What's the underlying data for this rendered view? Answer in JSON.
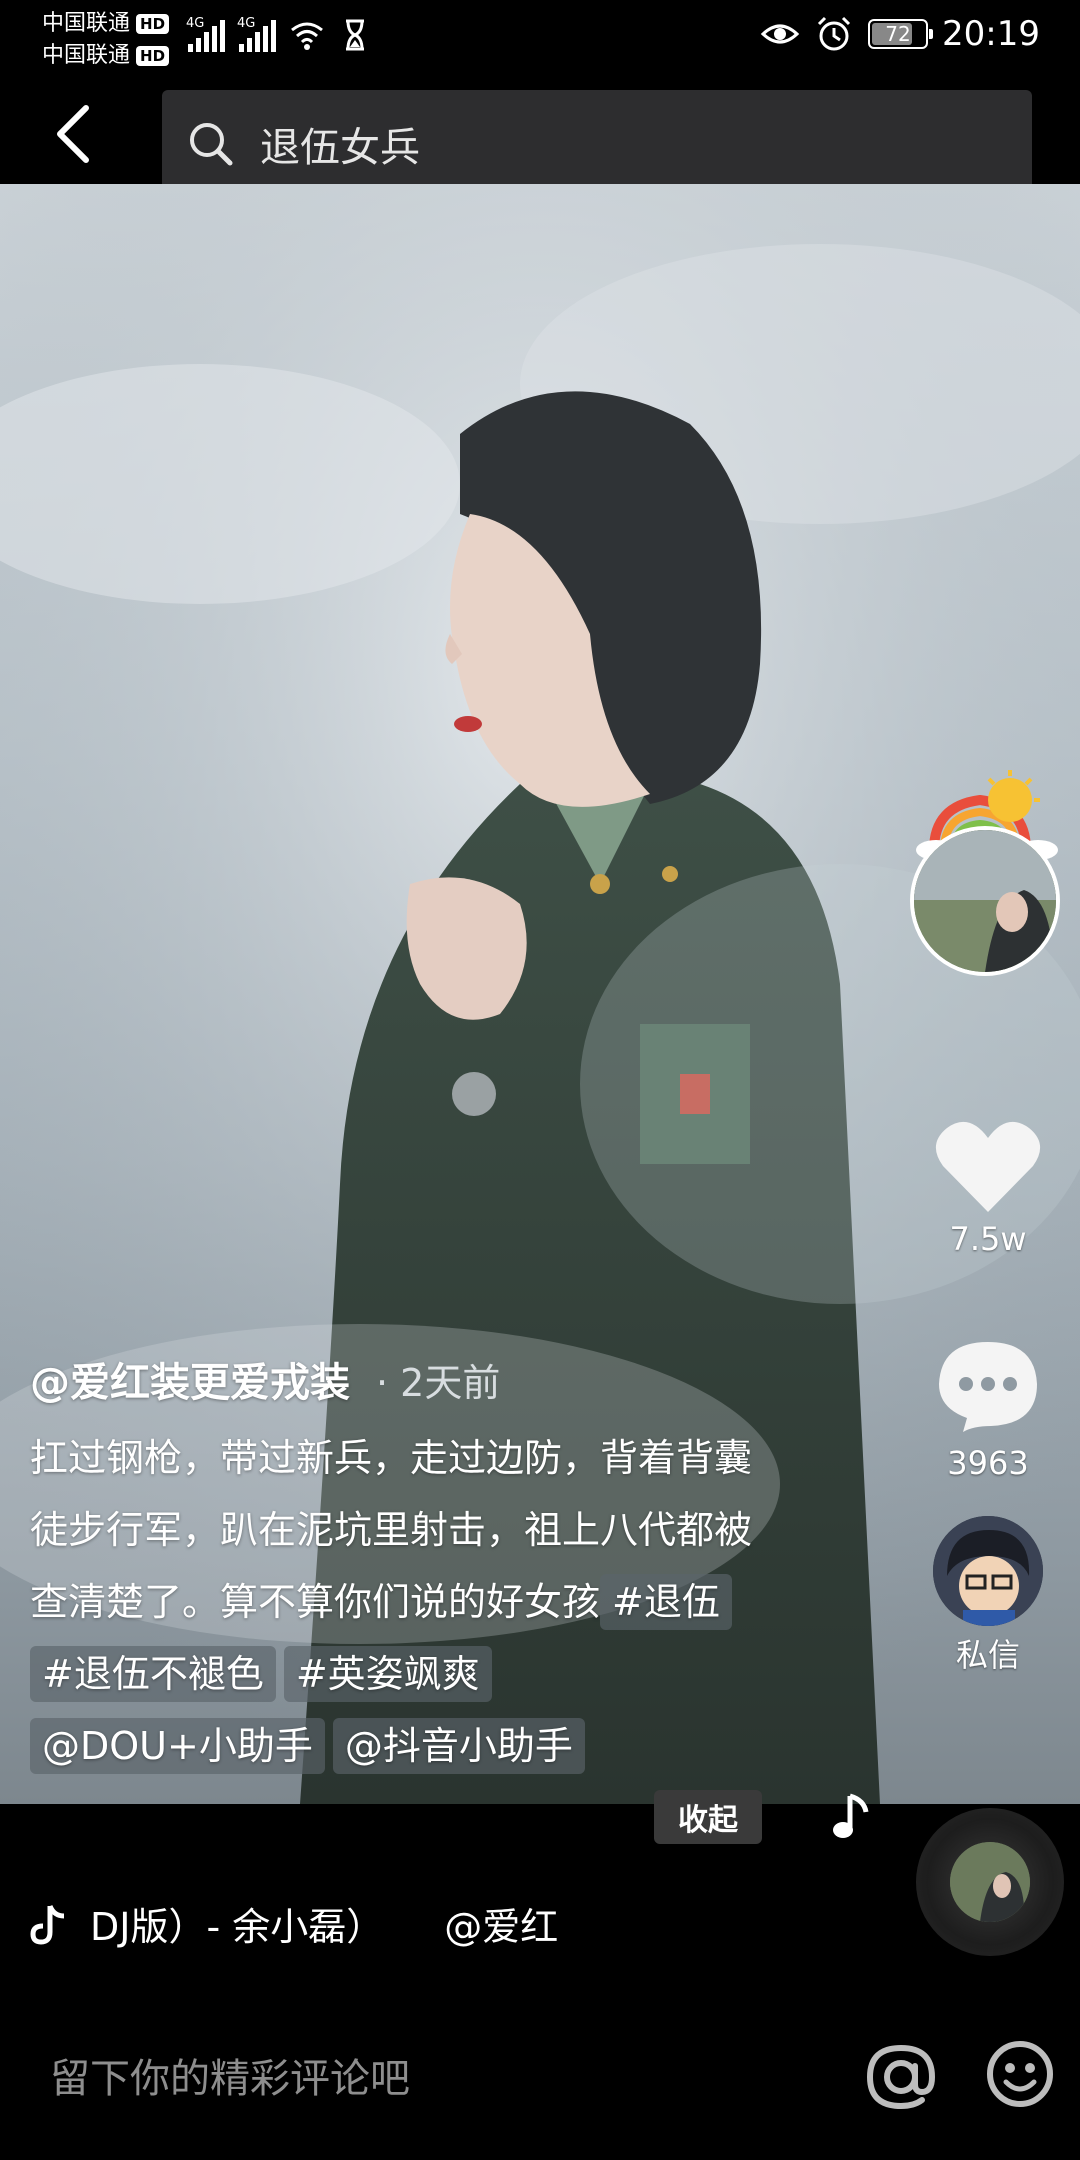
{
  "status_bar": {
    "carriers": [
      "中国联通",
      "中国联通"
    ],
    "hd_badge": "HD",
    "network_labels": [
      "4G",
      "4G"
    ],
    "battery": "72",
    "time": "20:19"
  },
  "search": {
    "query": "退伍女兵"
  },
  "rail": {
    "likes": "7.5w",
    "comments": "3963",
    "dm_label": "私信"
  },
  "caption": {
    "author": "@爱红装更爱戎装",
    "time_ago": "· 2天前",
    "text": "扛过钢枪，带过新兵，走过边防，背着背囊徒步行军，趴在泥坑里射击，祖上八代都被查清楚了。算不算你们说的好女孩",
    "tags": [
      "#退伍",
      "#退伍不褪色",
      "#英姿飒爽",
      "@DOU+小助手",
      "@抖音小助手"
    ]
  },
  "collapse_label": "收起",
  "music": {
    "title": "DJ版）- 余小磊）",
    "author": "@爱红"
  },
  "comment_bar": {
    "placeholder": "留下你的精彩评论吧"
  },
  "colors": {
    "background": "#000000",
    "tag_bg": "#5a646a",
    "search_bg": "#2d2d2f"
  }
}
